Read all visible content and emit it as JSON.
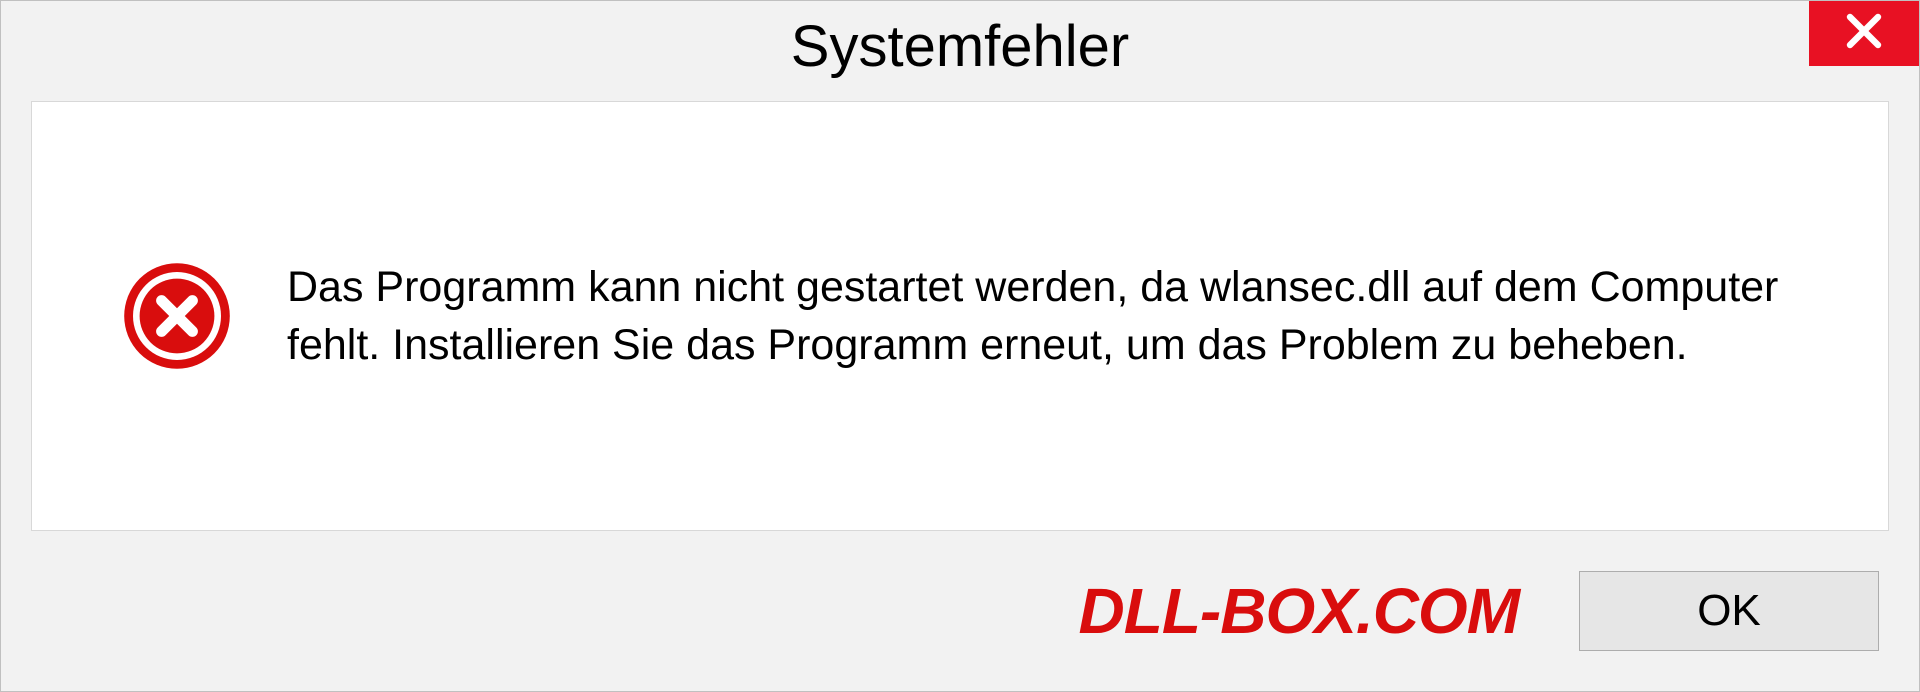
{
  "dialog": {
    "title": "Systemfehler",
    "message": "Das Programm kann nicht gestartet werden, da wlansec.dll auf dem Computer fehlt. Installieren Sie das Programm erneut, um das Problem zu beheben.",
    "ok_label": "OK"
  },
  "watermark": "DLL-BOX.COM",
  "colors": {
    "close_bg": "#e81123",
    "error_red": "#d90d0d"
  }
}
